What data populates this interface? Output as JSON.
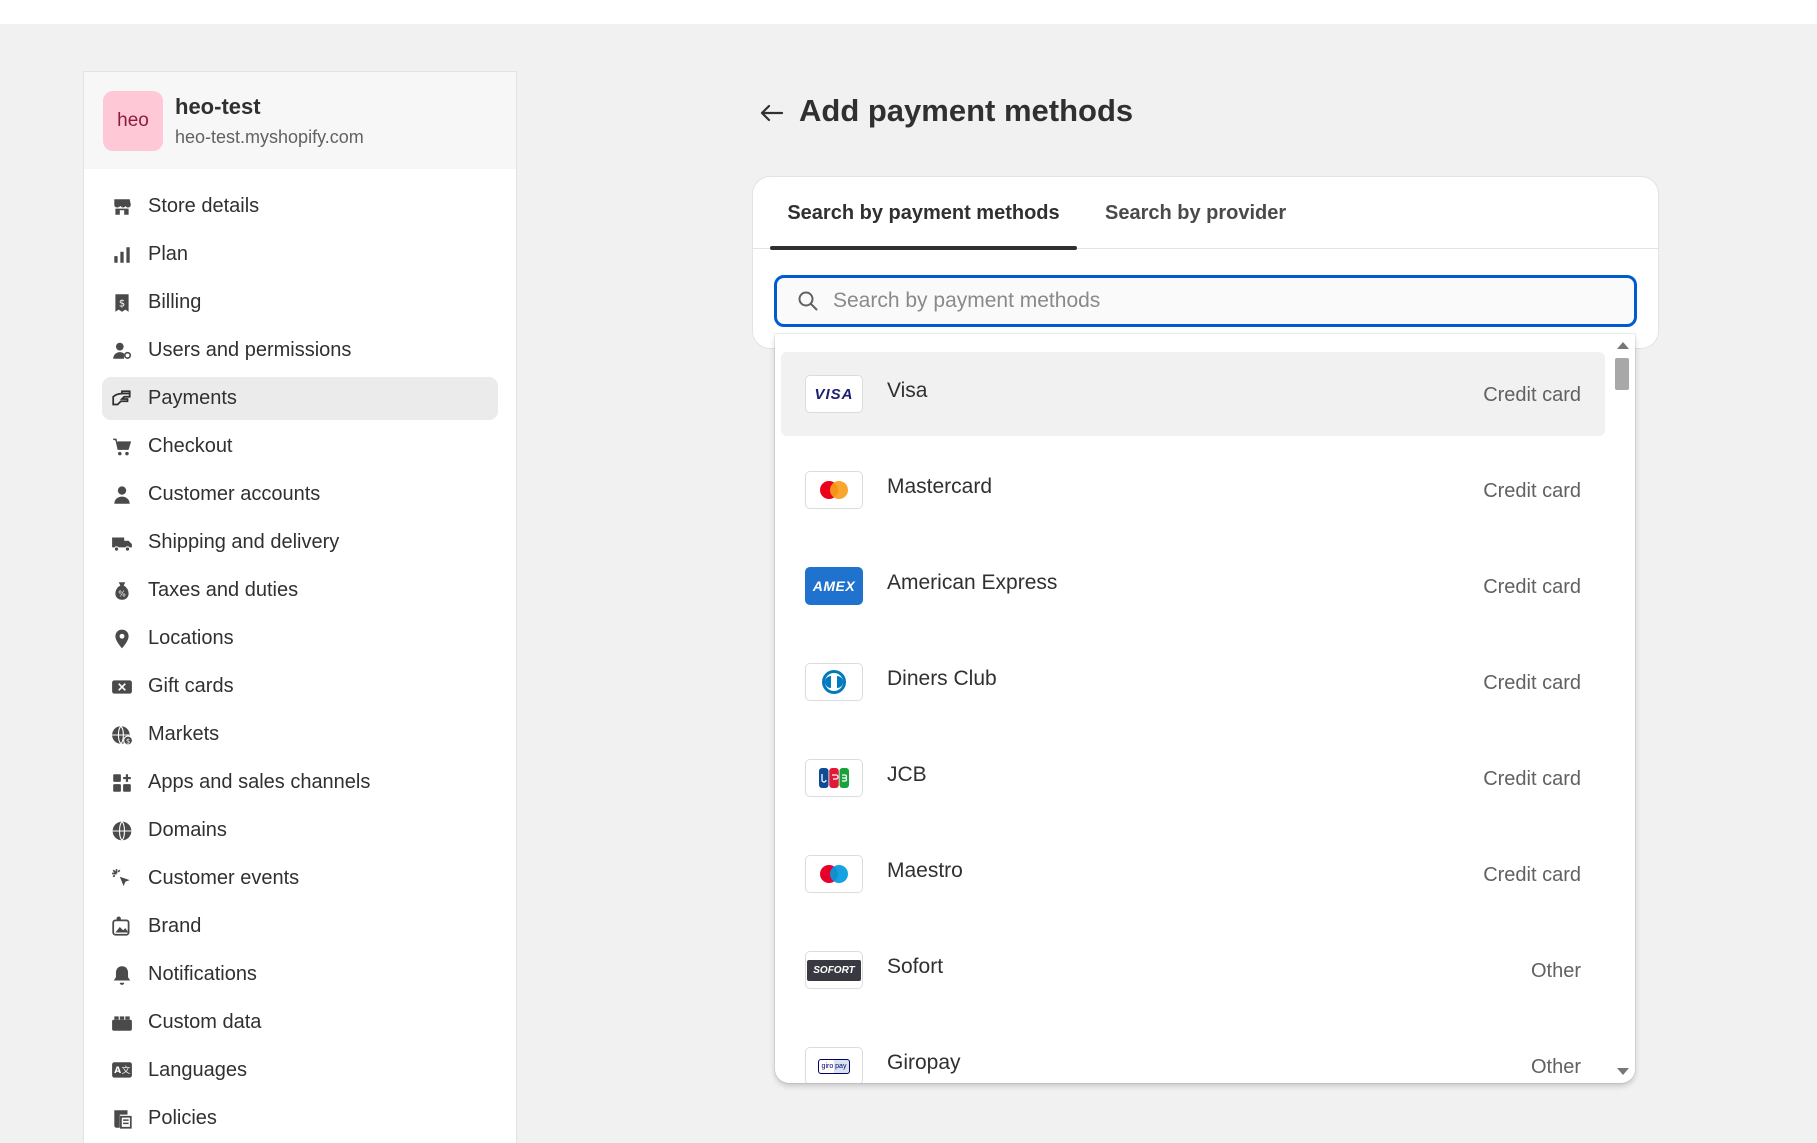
{
  "store": {
    "avatar_text": "heo",
    "name": "heo-test",
    "url": "heo-test.myshopify.com"
  },
  "sidebar": {
    "items": [
      {
        "label": "Store details",
        "icon": "store-icon"
      },
      {
        "label": "Plan",
        "icon": "plan-icon"
      },
      {
        "label": "Billing",
        "icon": "billing-icon"
      },
      {
        "label": "Users and permissions",
        "icon": "users-icon"
      },
      {
        "label": "Payments",
        "icon": "payments-icon",
        "active": true
      },
      {
        "label": "Checkout",
        "icon": "cart-icon"
      },
      {
        "label": "Customer accounts",
        "icon": "person-icon"
      },
      {
        "label": "Shipping and delivery",
        "icon": "truck-icon"
      },
      {
        "label": "Taxes and duties",
        "icon": "tax-icon"
      },
      {
        "label": "Locations",
        "icon": "location-icon"
      },
      {
        "label": "Gift cards",
        "icon": "gift-card-icon"
      },
      {
        "label": "Markets",
        "icon": "globe-currency-icon"
      },
      {
        "label": "Apps and sales channels",
        "icon": "apps-icon"
      },
      {
        "label": "Domains",
        "icon": "globe-icon"
      },
      {
        "label": "Customer events",
        "icon": "cursor-icon"
      },
      {
        "label": "Brand",
        "icon": "brand-icon"
      },
      {
        "label": "Notifications",
        "icon": "bell-icon"
      },
      {
        "label": "Custom data",
        "icon": "database-icon"
      },
      {
        "label": "Languages",
        "icon": "language-icon"
      },
      {
        "label": "Policies",
        "icon": "policy-icon"
      }
    ]
  },
  "main": {
    "title": "Add payment methods",
    "tabs": [
      {
        "label": "Search by payment methods",
        "selected": true
      },
      {
        "label": "Search by provider",
        "selected": false
      }
    ],
    "search": {
      "placeholder": "Search by payment methods",
      "value": ""
    },
    "results": [
      {
        "name": "Visa",
        "type": "Credit card",
        "logo": "visa-logo"
      },
      {
        "name": "Mastercard",
        "type": "Credit card",
        "logo": "mastercard-logo"
      },
      {
        "name": "American Express",
        "type": "Credit card",
        "logo": "amex-logo"
      },
      {
        "name": "Diners Club",
        "type": "Credit card",
        "logo": "diners-logo"
      },
      {
        "name": "JCB",
        "type": "Credit card",
        "logo": "jcb-logo"
      },
      {
        "name": "Maestro",
        "type": "Credit card",
        "logo": "maestro-logo"
      },
      {
        "name": "Sofort",
        "type": "Other",
        "logo": "sofort-logo"
      },
      {
        "name": "Giropay",
        "type": "Other",
        "logo": "giropay-logo"
      }
    ],
    "logo_text": {
      "visa": "VISA",
      "amex": "AMEX",
      "sofort": "SOFORT",
      "giropay": "giro pay"
    }
  },
  "colors": {
    "accent": "#005bd3",
    "avatar_bg": "#ffc8d7",
    "active_nav": "#ebebeb"
  }
}
